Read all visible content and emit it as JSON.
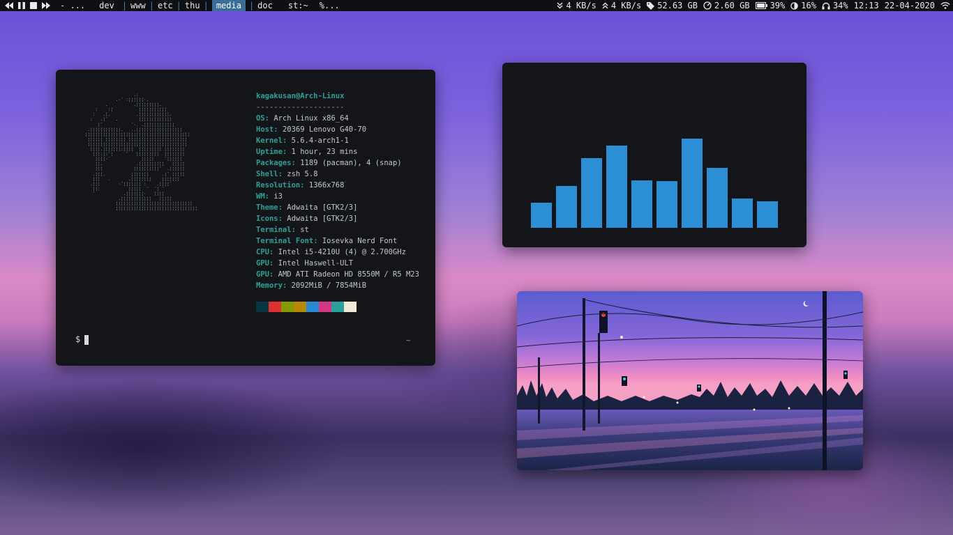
{
  "topbar": {
    "media_controls": [
      "prev-icon",
      "pause-icon",
      "stop-icon",
      "next-icon"
    ],
    "title_placeholder": "- ...",
    "workspaces": [
      {
        "label": "dev",
        "active": false
      },
      {
        "label": "www",
        "active": false
      },
      {
        "label": "etc",
        "active": false
      },
      {
        "label": "thu",
        "active": false
      },
      {
        "label": "media",
        "active": true
      },
      {
        "label": "doc",
        "active": false
      }
    ],
    "window_title": "st:~",
    "extra": "%...",
    "status": {
      "download": "4 KB/s",
      "upload": "4 KB/s",
      "disk": "52.63 GB",
      "memory": "2.60 GB",
      "battery": "39%",
      "brightness": "16%",
      "volume": "34%",
      "time": "12:13",
      "date": "22-04-2020"
    },
    "colors": {
      "bar_bg": "#0f1014",
      "active_ws": "#3a6d97",
      "separator": "#4a7ea8"
    }
  },
  "terminal": {
    "user_host": "kagakusan@Arch-Linux",
    "separator": "--------------------",
    "info": [
      {
        "key": "OS",
        "value": "Arch Linux x86_64"
      },
      {
        "key": "Host",
        "value": "20369 Lenovo G40-70"
      },
      {
        "key": "Kernel",
        "value": "5.6.4-arch1-1"
      },
      {
        "key": "Uptime",
        "value": "1 hour, 23 mins"
      },
      {
        "key": "Packages",
        "value": "1189 (pacman), 4 (snap)"
      },
      {
        "key": "Shell",
        "value": "zsh 5.8"
      },
      {
        "key": "Resolution",
        "value": "1366x768"
      },
      {
        "key": "WM",
        "value": "i3"
      },
      {
        "key": "Theme",
        "value": "Adwaita [GTK2/3]"
      },
      {
        "key": "Icons",
        "value": "Adwaita [GTK2/3]"
      },
      {
        "key": "Terminal",
        "value": "st"
      },
      {
        "key": "Terminal Font",
        "value": "Iosevka Nerd Font"
      },
      {
        "key": "CPU",
        "value": "Intel i5-4210U (4) @ 2.700GHz"
      },
      {
        "key": "GPU",
        "value": "Intel Haswell-ULT"
      },
      {
        "key": "GPU",
        "value": "AMD ATI Radeon HD 8550M / R5 M23"
      },
      {
        "key": "Memory",
        "value": "2092MiB / 7854MiB"
      }
    ],
    "palette": [
      "#073642",
      "#dc322f",
      "#859900",
      "#b58900",
      "#268bd2",
      "#d33682",
      "#2aa198",
      "#eee8d5"
    ],
    "prompt": "$",
    "right_prompt": "~",
    "key_color": "#2aa198"
  },
  "visualizer": {
    "bar_color": "#2b8fd6",
    "levels": [
      0.28,
      0.47,
      0.78,
      0.92,
      0.53,
      0.52,
      1.0,
      0.67,
      0.33,
      0.3
    ]
  },
  "wallpaper": {
    "description_icon": "sunset-street-painting"
  }
}
